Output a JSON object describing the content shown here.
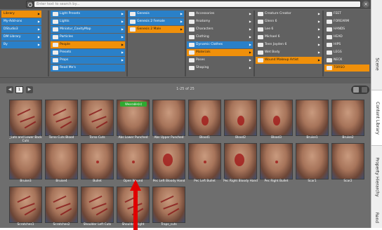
{
  "search": {
    "placeholder": "Enter text to search by..."
  },
  "tree": {
    "columns": [
      {
        "items": [
          {
            "label": "Library",
            "state": "orange",
            "arrow": true
          },
          {
            "label": "My-Add-ons",
            "state": "blue",
            "arrow": true
          },
          {
            "label": "DStudio3",
            "state": "blue",
            "arrow": true
          },
          {
            "label": "DM Library",
            "state": "blue",
            "arrow": true
          },
          {
            "label": "By",
            "state": "blue",
            "arrow": true
          }
        ]
      },
      {
        "items": [
          {
            "label": "Light Presets",
            "state": "blue",
            "arrow": true
          },
          {
            "label": "Lights",
            "state": "blue",
            "arrow": true
          },
          {
            "label": "Miniatur_CavityMap",
            "state": "blue",
            "arrow": true
          },
          {
            "label": "Particles",
            "state": "blue",
            "arrow": true
          },
          {
            "label": "People",
            "state": "orange",
            "arrow": true
          },
          {
            "label": "Presets",
            "state": "blue",
            "arrow": true
          },
          {
            "label": "Props",
            "state": "blue",
            "arrow": true
          },
          {
            "label": "Read Me's",
            "state": "blue",
            "arrow": false
          }
        ]
      },
      {
        "items": [
          {
            "label": "Genesis",
            "state": "blue",
            "arrow": true
          },
          {
            "label": "Genesis 2 Female",
            "state": "blue",
            "arrow": true
          },
          {
            "label": "Genesis 2 Male",
            "state": "orange",
            "arrow": true
          }
        ]
      },
      {
        "items": [
          {
            "label": "Accessories",
            "state": "none",
            "arrow": true
          },
          {
            "label": "Anatomy",
            "state": "none",
            "arrow": true
          },
          {
            "label": "Characters",
            "state": "none",
            "arrow": true
          },
          {
            "label": "Clothing",
            "state": "none",
            "arrow": true
          },
          {
            "label": "Dynamic Clothes",
            "state": "blue",
            "arrow": true
          },
          {
            "label": "Materials",
            "state": "orange",
            "arrow": true
          },
          {
            "label": "Poses",
            "state": "none",
            "arrow": true
          },
          {
            "label": "Shaping",
            "state": "none",
            "arrow": true
          }
        ]
      },
      {
        "items": [
          {
            "label": "Creature Creator",
            "state": "none",
            "arrow": true
          },
          {
            "label": "Glenn 6",
            "state": "none",
            "arrow": true
          },
          {
            "label": "Lee 6",
            "state": "none",
            "arrow": true
          },
          {
            "label": "Michael 6",
            "state": "none",
            "arrow": true
          },
          {
            "label": "Teen Jayden 6",
            "state": "none",
            "arrow": true
          },
          {
            "label": "Wet Body",
            "state": "none",
            "arrow": true
          },
          {
            "label": "Wound Makeup Artist",
            "state": "orange",
            "arrow": true
          }
        ]
      },
      {
        "items": [
          {
            "label": "FEET",
            "state": "none",
            "arrow": false
          },
          {
            "label": "FOREARM",
            "state": "none",
            "arrow": false
          },
          {
            "label": "HANDS",
            "state": "none",
            "arrow": false
          },
          {
            "label": "HEAD",
            "state": "none",
            "arrow": false
          },
          {
            "label": "HIPS",
            "state": "none",
            "arrow": false
          },
          {
            "label": "LEGS",
            "state": "none",
            "arrow": false
          },
          {
            "label": "NECK",
            "state": "none",
            "arrow": false
          },
          {
            "label": "TORSO",
            "state": "orange",
            "arrow": false
          }
        ]
      }
    ]
  },
  "pager": {
    "page": "1",
    "count": "1-25 of 25"
  },
  "grid": {
    "items": [
      {
        "label": "_Lats and Lower Back Cuts",
        "variant": "cuts"
      },
      {
        "label": "Torso Cuts Blood",
        "variant": "cuts"
      },
      {
        "label": "Torso Cuts",
        "variant": "cuts"
      },
      {
        "label": "Abs Lower Punched",
        "variant": "plain",
        "badge": "Wearable(s)"
      },
      {
        "label": "Abs Upper Punched",
        "variant": "plain"
      },
      {
        "label": "Blood1",
        "variant": "blood"
      },
      {
        "label": "Blood2",
        "variant": "blood"
      },
      {
        "label": "Blood3",
        "variant": "blood"
      },
      {
        "label": "Bruise1",
        "variant": "plain"
      },
      {
        "label": "Bruise2",
        "variant": "plain"
      },
      {
        "label": "Bruise3",
        "variant": "plain"
      },
      {
        "label": "Bruise4",
        "variant": "plain"
      },
      {
        "label": "Bullet",
        "variant": "spot"
      },
      {
        "label": "Open Wound",
        "variant": "spot"
      },
      {
        "label": "Pec Left Bloody Hand",
        "variant": "hand"
      },
      {
        "label": "Pec Left Bullet",
        "variant": "spot"
      },
      {
        "label": "Pec Right Bloody Hand",
        "variant": "hand"
      },
      {
        "label": "Pec Right Bullet",
        "variant": "spot"
      },
      {
        "label": "Scar1",
        "variant": "plain"
      },
      {
        "label": "Scar2",
        "variant": "plain"
      },
      {
        "label": "Scratches1",
        "variant": "cuts"
      },
      {
        "label": "Scratches2",
        "variant": "cuts"
      },
      {
        "label": "Shoulder Left Cuts",
        "variant": "cuts"
      },
      {
        "label": "Shoulder Right",
        "variant": "cuts"
      },
      {
        "label": "Traps_cuts",
        "variant": "cuts"
      }
    ]
  },
  "side_tabs": [
    {
      "label": "Scene",
      "active": false
    },
    {
      "label": "Content Library",
      "active": true
    },
    {
      "label": "Property Hierarchy",
      "active": false
    },
    {
      "label": "Rend",
      "active": false
    }
  ],
  "colors": {
    "accent_blue": "#2a80c8",
    "accent_orange": "#f0900a",
    "annotation_arrow": "#e00000"
  }
}
